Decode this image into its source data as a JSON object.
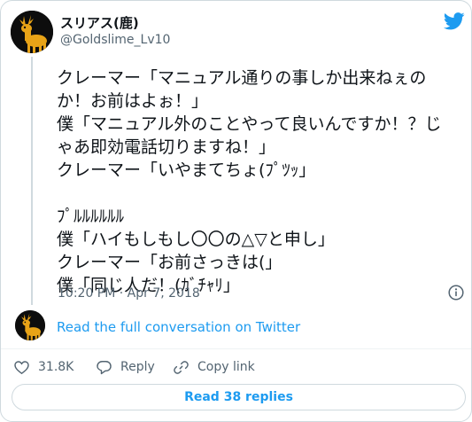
{
  "author": {
    "display_name": "スリアス(鹿)",
    "handle": "@Goldslime_Lv10",
    "avatar_icon": "deer-avatar-icon"
  },
  "brand": {
    "icon": "twitter-bird-icon",
    "color": "#1d9bf0"
  },
  "tweet": {
    "lines": [
      "クレーマー「マニュアル通りの事しか出来ねぇの",
      "か！お前はよぉ！」",
      "僕「マニュアル外のことやって良いんですか！？じ",
      "ゃあ即効電話切りますね！」",
      "クレーマー「いやまてちょ(ﾌﾟﾂｯ」",
      "",
      "ﾌﾟﾙﾙﾙﾙﾙﾙ",
      "僕「ハイもしもし〇〇の△▽と申し」",
      "クレーマー「お前さっきは(」",
      "僕「同じ人だ！(ｶﾞﾁｬﾘ」"
    ],
    "timestamp": "10:20 PM · Apr 7, 2018"
  },
  "conversation": {
    "link_label": "Read the full conversation on Twitter"
  },
  "actions": {
    "like_count": "31.8K",
    "reply_label": "Reply",
    "copy_label": "Copy link"
  },
  "replies": {
    "label": "Read 38 replies"
  },
  "colors": {
    "accent": "#1d9bf0",
    "secondary_text": "#536471",
    "border": "#cfd9de",
    "deer": "#e8a317"
  }
}
